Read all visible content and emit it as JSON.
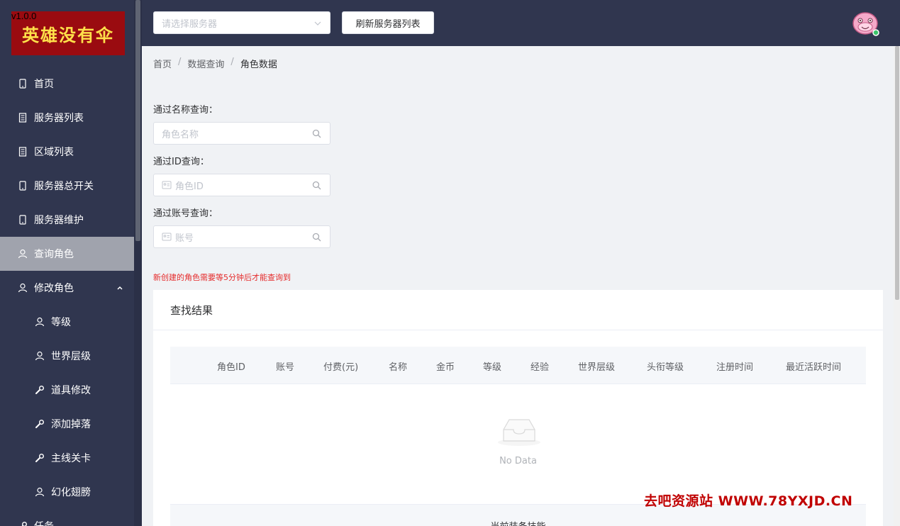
{
  "brand": {
    "logo_text": "英雄没有伞",
    "version": "v1.0.0"
  },
  "header": {
    "server_select_placeholder": "请选择服务器",
    "refresh_label": "刷新服务器列表"
  },
  "sidebar": {
    "items": [
      {
        "label": "首页",
        "icon": "phone-icon"
      },
      {
        "label": "服务器列表",
        "icon": "document-icon"
      },
      {
        "label": "区域列表",
        "icon": "document-icon"
      },
      {
        "label": "服务器总开关",
        "icon": "phone-icon"
      },
      {
        "label": "服务器维护",
        "icon": "phone-icon"
      },
      {
        "label": "查询角色",
        "icon": "user-icon",
        "active": true
      },
      {
        "label": "修改角色",
        "icon": "user-icon",
        "expanded": true
      },
      {
        "label": "等级",
        "icon": "user-icon"
      },
      {
        "label": "世界层级",
        "icon": "user-icon"
      },
      {
        "label": "道具修改",
        "icon": "wrench-icon"
      },
      {
        "label": "添加掉落",
        "icon": "wrench-icon"
      },
      {
        "label": "主线关卡",
        "icon": "wrench-icon"
      },
      {
        "label": "幻化翅膀",
        "icon": "user-icon"
      },
      {
        "label": "任务",
        "icon": "wrench-icon"
      }
    ]
  },
  "breadcrumb": {
    "home": "首页",
    "data_query": "数据查询",
    "current": "角色数据"
  },
  "search": {
    "by_name_label": "通过名称查询：",
    "by_name_placeholder": "角色名称",
    "by_id_label": "通过ID查询：",
    "by_id_placeholder": "角色ID",
    "by_account_label": "通过账号查询：",
    "by_account_placeholder": "账号"
  },
  "notice": "新创建的角色需要等5分钟后才能查询到",
  "results": {
    "title": "查找结果",
    "columns": [
      "角色ID",
      "账号",
      "付费(元)",
      "名称",
      "金币",
      "等级",
      "经验",
      "世界层级",
      "头衔等级",
      "注册时间",
      "最近活跃时间"
    ],
    "empty_text": "No Data",
    "equipped_skills_title": "当前装备技能"
  },
  "watermark": "去吧资源站 WWW.78YXJD.CN",
  "colors": {
    "sidebar_bg": "#30364f",
    "active_item_bg": "#a0a3ad",
    "notice": "#e52b2b",
    "logo_bg": "#9a0b10",
    "logo_text": "#ffe14a"
  }
}
